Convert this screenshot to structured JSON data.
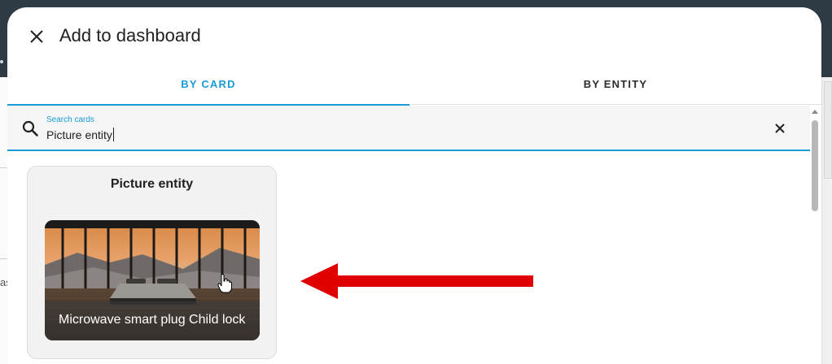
{
  "dialog": {
    "title": "Add to dashboard",
    "tabs": [
      {
        "label": "BY CARD",
        "active": true
      },
      {
        "label": "BY ENTITY",
        "active": false
      }
    ],
    "search": {
      "label": "Search cards",
      "value": "Picture entity"
    }
  },
  "cards": [
    {
      "title": "Picture entity",
      "preview_label": "Microwave smart plug Child lock"
    }
  ],
  "colors": {
    "accent": "#1a9bd7",
    "arrow": "#e00000",
    "header_background": "#2f3b44"
  },
  "icons": {
    "close": "close-icon",
    "search": "search-icon",
    "clear": "clear-icon",
    "pointer": "hand-pointer-icon",
    "annotation": "left-arrow-icon"
  },
  "background_fragment": "as"
}
